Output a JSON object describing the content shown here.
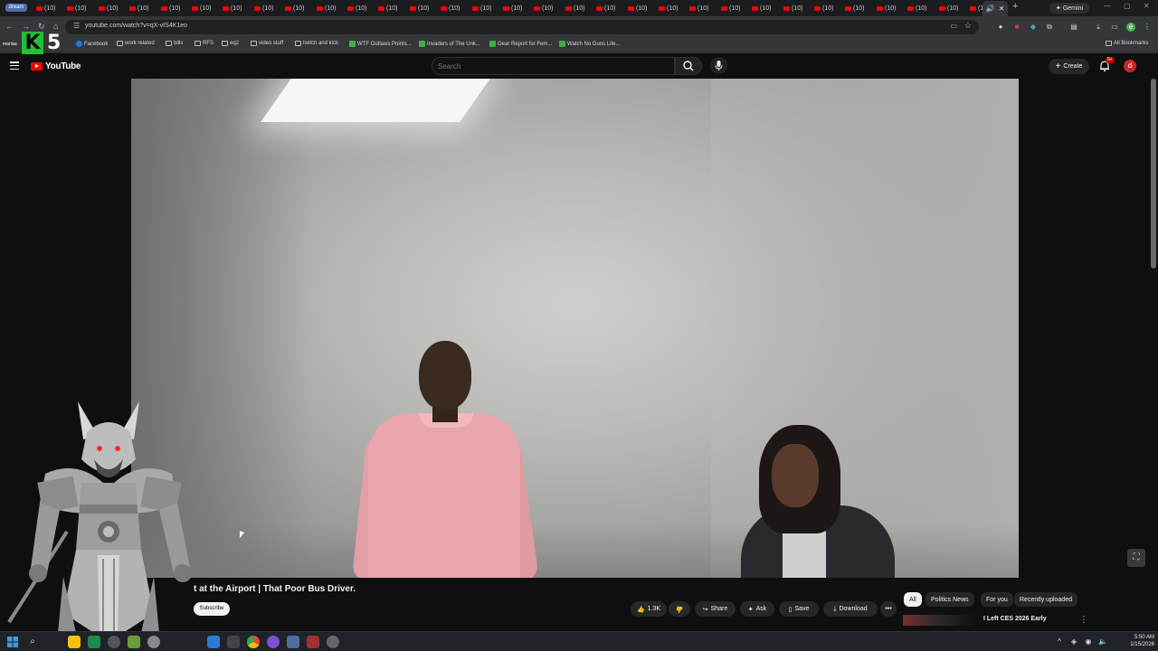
{
  "browser": {
    "first_tab_label": "dream",
    "tab_label": "(10)",
    "active_tab_icon": "speaker-icon",
    "new_tab_glyph": "+",
    "gemini_label": "Gemini",
    "url": "youtube.com/watch?v=qX-vIS4K1eo",
    "bookmarks": [
      {
        "label": "Facebook",
        "icon": "facebook-icon"
      },
      {
        "label": "work related",
        "icon": "folder-icon"
      },
      {
        "label": "bills",
        "icon": "folder-icon"
      },
      {
        "label": "RFS",
        "icon": "folder-icon"
      },
      {
        "label": "eq2",
        "icon": "folder-icon"
      },
      {
        "label": "video stuff",
        "icon": "folder-icon"
      },
      {
        "label": "twitch and kick",
        "icon": "folder-icon"
      },
      {
        "label": "WTF Outlaws Points...",
        "icon": "site-icon"
      },
      {
        "label": "Invaders of The Unk...",
        "icon": "site-icon"
      },
      {
        "label": "Gear Report for Fem...",
        "icon": "site-icon"
      },
      {
        "label": "Watch No Guns Life...",
        "icon": "site-icon"
      }
    ],
    "all_bookmarks_label": "All Bookmarks"
  },
  "overlay": {
    "logo_k": "K",
    "logo_five": "5",
    "logo_sub": "maniac"
  },
  "youtube": {
    "logo_text": "YouTube",
    "search_placeholder": "Search",
    "create_label": "Create",
    "notifications_badge": "9+",
    "avatar_letter": "d",
    "video_title": "t at the Airport | That Poor Bus Driver.",
    "subscribe_label": "Subscribe",
    "actions": {
      "likes": "1.3K",
      "share": "Share",
      "ask": "Ask",
      "save": "Save",
      "download": "Download",
      "more": "•••"
    },
    "chips": [
      "All",
      "Politics News",
      "For you",
      "Recently uploaded"
    ],
    "recommended": {
      "title": "I Left CES 2026 Early"
    }
  },
  "taskbar": {
    "time": "5:50 AM",
    "date": "1/15/2026"
  },
  "colors": {
    "yt_red": "#ff0000",
    "background": "#0f0f0f",
    "chip_bg": "#272727",
    "k5_green": "#22c032"
  }
}
